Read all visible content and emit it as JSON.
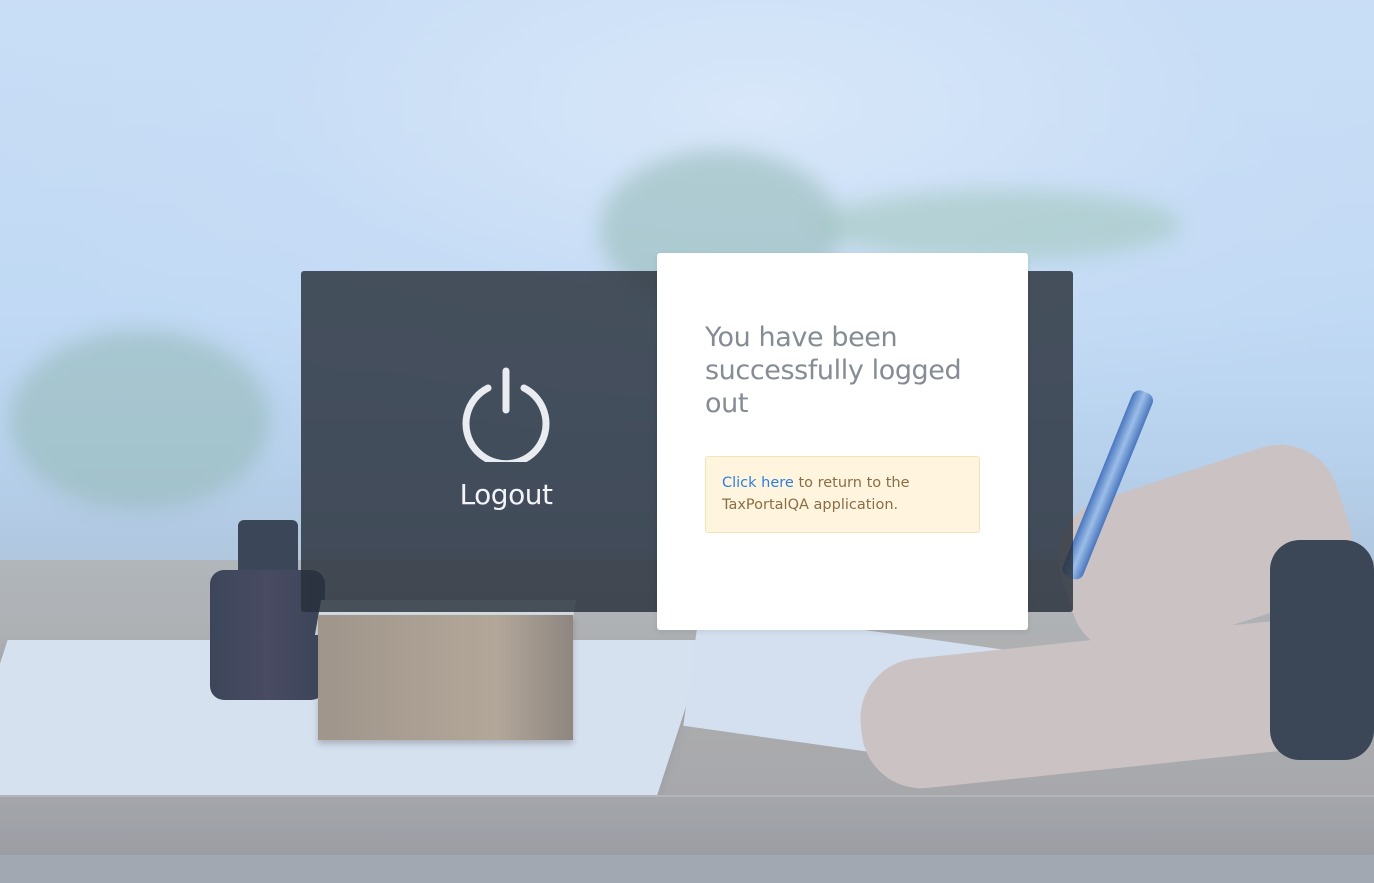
{
  "logout_panel": {
    "icon": "power-icon",
    "title": "Logout"
  },
  "message": {
    "heading": "You have been successfully logged out",
    "notice": {
      "link_text": "Click here",
      "text_before_app": " to return to the",
      "app_name": "TaxPortalQA",
      "text_after_app": " application."
    }
  },
  "colors": {
    "dark_panel": "#282f3a",
    "card_background": "#ffffff",
    "heading_text": "#858c94",
    "notice_background": "#fff5de",
    "notice_border": "#f5e3b8",
    "notice_text": "#8a6d44",
    "link": "#2f7de1"
  }
}
